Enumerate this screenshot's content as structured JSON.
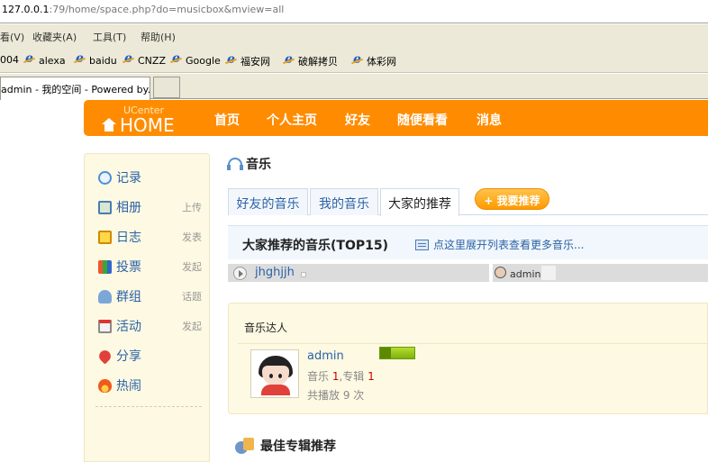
{
  "browser": {
    "address_host": "127.0.0.1",
    "address_path": ":79/home/space.php?do=musicbox&mview=all",
    "menu": [
      "看(V)",
      "收藏夹(A)",
      "工具(T)",
      "帮助(H)"
    ],
    "favorites": [
      "004",
      "alexa",
      "baidu",
      "CNZZ",
      "Google",
      "福安网",
      "破解拷贝",
      "体彩网"
    ],
    "tab_title": "admin - 我的空间 - Powered by..."
  },
  "site": {
    "brand_small": "UCenter",
    "brand_main": "HOME",
    "nav": [
      "首页",
      "个人主页",
      "好友",
      "随便看看",
      "消息"
    ],
    "accent_color": "#ff8c00"
  },
  "sidebar": {
    "items": [
      {
        "label": "记录",
        "sub": "",
        "icon": "speech-bubble-icon"
      },
      {
        "label": "相册",
        "sub": "上传",
        "icon": "photo-icon"
      },
      {
        "label": "日志",
        "sub": "发表",
        "icon": "journal-icon"
      },
      {
        "label": "投票",
        "sub": "发起",
        "icon": "bar-chart-icon"
      },
      {
        "label": "群组",
        "sub": "话题",
        "icon": "group-icon"
      },
      {
        "label": "活动",
        "sub": "发起",
        "icon": "calendar-icon"
      },
      {
        "label": "分享",
        "sub": "",
        "icon": "heart-icon"
      },
      {
        "label": "热闹",
        "sub": "",
        "icon": "flame-icon"
      }
    ]
  },
  "main": {
    "section_title": "音乐",
    "tabs": [
      "好友的音乐",
      "我的音乐",
      "大家的推荐"
    ],
    "active_tab": "大家的推荐",
    "recommend_button": "+ 我要推荐",
    "top15_title": "大家推荐的音乐(TOP15)",
    "expand_link": "点这里展开列表查看更多音乐...",
    "track": {
      "name": "jhghjjh",
      "user": "admin"
    },
    "talent": {
      "title": "音乐达人",
      "name": "admin",
      "music_label": "音乐",
      "music_count": "1",
      "album_label": ",专辑",
      "album_count": "1",
      "plays_text": "共播放 9 次"
    },
    "album_section_title": "最佳专辑推荐"
  }
}
